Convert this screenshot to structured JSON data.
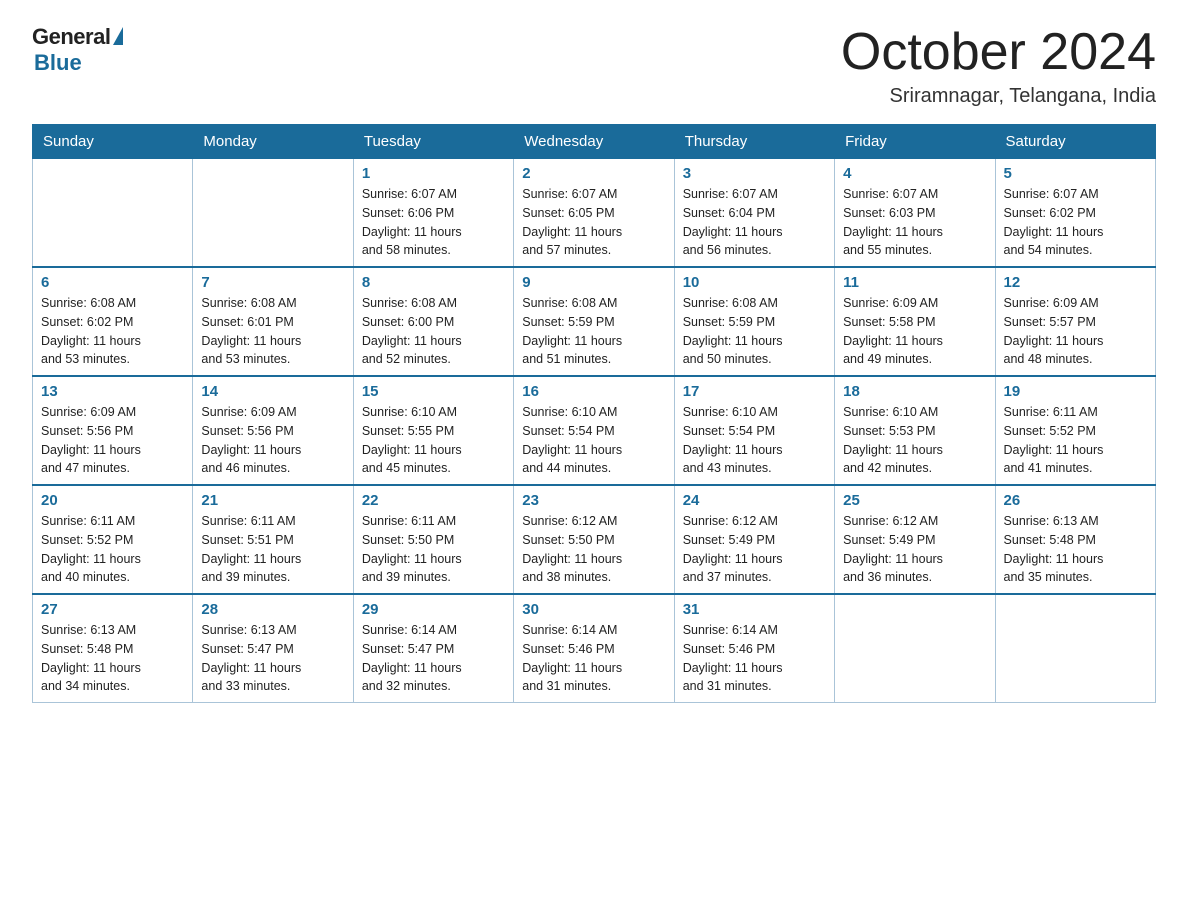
{
  "logo": {
    "general": "General",
    "blue": "Blue"
  },
  "header": {
    "month": "October 2024",
    "location": "Sriramnagar, Telangana, India"
  },
  "days_of_week": [
    "Sunday",
    "Monday",
    "Tuesday",
    "Wednesday",
    "Thursday",
    "Friday",
    "Saturday"
  ],
  "weeks": [
    [
      {
        "day": "",
        "info": ""
      },
      {
        "day": "",
        "info": ""
      },
      {
        "day": "1",
        "info": "Sunrise: 6:07 AM\nSunset: 6:06 PM\nDaylight: 11 hours\nand 58 minutes."
      },
      {
        "day": "2",
        "info": "Sunrise: 6:07 AM\nSunset: 6:05 PM\nDaylight: 11 hours\nand 57 minutes."
      },
      {
        "day": "3",
        "info": "Sunrise: 6:07 AM\nSunset: 6:04 PM\nDaylight: 11 hours\nand 56 minutes."
      },
      {
        "day": "4",
        "info": "Sunrise: 6:07 AM\nSunset: 6:03 PM\nDaylight: 11 hours\nand 55 minutes."
      },
      {
        "day": "5",
        "info": "Sunrise: 6:07 AM\nSunset: 6:02 PM\nDaylight: 11 hours\nand 54 minutes."
      }
    ],
    [
      {
        "day": "6",
        "info": "Sunrise: 6:08 AM\nSunset: 6:02 PM\nDaylight: 11 hours\nand 53 minutes."
      },
      {
        "day": "7",
        "info": "Sunrise: 6:08 AM\nSunset: 6:01 PM\nDaylight: 11 hours\nand 53 minutes."
      },
      {
        "day": "8",
        "info": "Sunrise: 6:08 AM\nSunset: 6:00 PM\nDaylight: 11 hours\nand 52 minutes."
      },
      {
        "day": "9",
        "info": "Sunrise: 6:08 AM\nSunset: 5:59 PM\nDaylight: 11 hours\nand 51 minutes."
      },
      {
        "day": "10",
        "info": "Sunrise: 6:08 AM\nSunset: 5:59 PM\nDaylight: 11 hours\nand 50 minutes."
      },
      {
        "day": "11",
        "info": "Sunrise: 6:09 AM\nSunset: 5:58 PM\nDaylight: 11 hours\nand 49 minutes."
      },
      {
        "day": "12",
        "info": "Sunrise: 6:09 AM\nSunset: 5:57 PM\nDaylight: 11 hours\nand 48 minutes."
      }
    ],
    [
      {
        "day": "13",
        "info": "Sunrise: 6:09 AM\nSunset: 5:56 PM\nDaylight: 11 hours\nand 47 minutes."
      },
      {
        "day": "14",
        "info": "Sunrise: 6:09 AM\nSunset: 5:56 PM\nDaylight: 11 hours\nand 46 minutes."
      },
      {
        "day": "15",
        "info": "Sunrise: 6:10 AM\nSunset: 5:55 PM\nDaylight: 11 hours\nand 45 minutes."
      },
      {
        "day": "16",
        "info": "Sunrise: 6:10 AM\nSunset: 5:54 PM\nDaylight: 11 hours\nand 44 minutes."
      },
      {
        "day": "17",
        "info": "Sunrise: 6:10 AM\nSunset: 5:54 PM\nDaylight: 11 hours\nand 43 minutes."
      },
      {
        "day": "18",
        "info": "Sunrise: 6:10 AM\nSunset: 5:53 PM\nDaylight: 11 hours\nand 42 minutes."
      },
      {
        "day": "19",
        "info": "Sunrise: 6:11 AM\nSunset: 5:52 PM\nDaylight: 11 hours\nand 41 minutes."
      }
    ],
    [
      {
        "day": "20",
        "info": "Sunrise: 6:11 AM\nSunset: 5:52 PM\nDaylight: 11 hours\nand 40 minutes."
      },
      {
        "day": "21",
        "info": "Sunrise: 6:11 AM\nSunset: 5:51 PM\nDaylight: 11 hours\nand 39 minutes."
      },
      {
        "day": "22",
        "info": "Sunrise: 6:11 AM\nSunset: 5:50 PM\nDaylight: 11 hours\nand 39 minutes."
      },
      {
        "day": "23",
        "info": "Sunrise: 6:12 AM\nSunset: 5:50 PM\nDaylight: 11 hours\nand 38 minutes."
      },
      {
        "day": "24",
        "info": "Sunrise: 6:12 AM\nSunset: 5:49 PM\nDaylight: 11 hours\nand 37 minutes."
      },
      {
        "day": "25",
        "info": "Sunrise: 6:12 AM\nSunset: 5:49 PM\nDaylight: 11 hours\nand 36 minutes."
      },
      {
        "day": "26",
        "info": "Sunrise: 6:13 AM\nSunset: 5:48 PM\nDaylight: 11 hours\nand 35 minutes."
      }
    ],
    [
      {
        "day": "27",
        "info": "Sunrise: 6:13 AM\nSunset: 5:48 PM\nDaylight: 11 hours\nand 34 minutes."
      },
      {
        "day": "28",
        "info": "Sunrise: 6:13 AM\nSunset: 5:47 PM\nDaylight: 11 hours\nand 33 minutes."
      },
      {
        "day": "29",
        "info": "Sunrise: 6:14 AM\nSunset: 5:47 PM\nDaylight: 11 hours\nand 32 minutes."
      },
      {
        "day": "30",
        "info": "Sunrise: 6:14 AM\nSunset: 5:46 PM\nDaylight: 11 hours\nand 31 minutes."
      },
      {
        "day": "31",
        "info": "Sunrise: 6:14 AM\nSunset: 5:46 PM\nDaylight: 11 hours\nand 31 minutes."
      },
      {
        "day": "",
        "info": ""
      },
      {
        "day": "",
        "info": ""
      }
    ]
  ]
}
